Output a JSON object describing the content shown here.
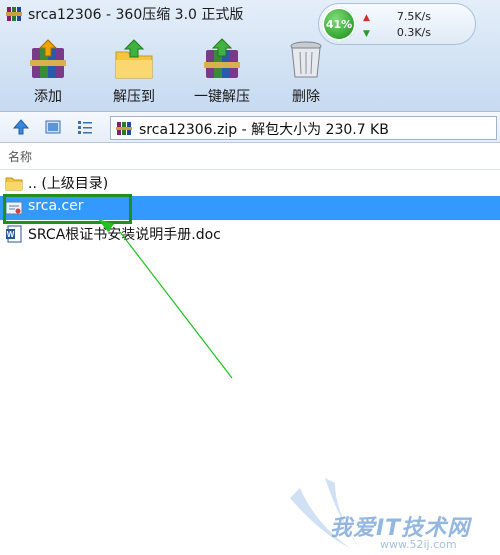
{
  "window": {
    "title": "srca12306 - 360压缩 3.0 正式版"
  },
  "gauge": {
    "percent": "41%",
    "upload": "7.5K/s",
    "download": "0.3K/s"
  },
  "toolbar": {
    "add_label": "添加",
    "extract_to_label": "解压到",
    "one_click_extract_label": "一键解压",
    "delete_label": "删除"
  },
  "address": {
    "text": "srca12306.zip - 解包大小为 230.7 KB"
  },
  "list": {
    "column_name": "名称",
    "items": [
      {
        "name": ".. (上级目录)",
        "icon": "folder-icon",
        "selected": false
      },
      {
        "name": "srca.cer",
        "icon": "certificate-icon",
        "selected": true
      },
      {
        "name": "SRCA根证书安装说明手册.doc",
        "icon": "word-doc-icon",
        "selected": false
      }
    ]
  },
  "annotation": {
    "highlight_color": "#1f8f1f",
    "arrow_color": "#22c022"
  },
  "watermark": {
    "text": "我爱IT技术网",
    "url": "www.52ij.com"
  },
  "colors": {
    "selection": "#3399ff",
    "toolbar_bg": "#d3e3f4"
  }
}
